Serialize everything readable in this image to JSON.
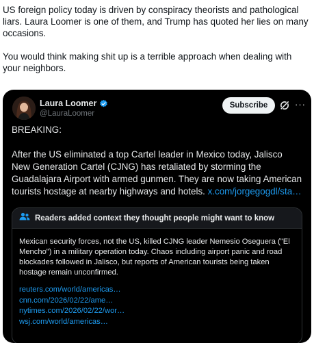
{
  "post": {
    "paragraph1": "US foreign policy today is driven by conspiracy theorists and pathological liars. Laura Loomer is one of them, and Trump has quoted her lies on many occasions.",
    "paragraph2": "You would think making shit up is a terrible approach when dealing with your neighbors."
  },
  "quoted": {
    "display_name": "Laura Loomer",
    "handle": "@LauraLoomer",
    "subscribe_label": "Subscribe",
    "more_label": "···",
    "breaking": "BREAKING:",
    "body": "After the US eliminated a top Cartel leader in Mexico today, Jalisco New Generation Cartel (CJNG) has retaliated by storming the Guadalajara Airport with armed gunmen. They are now taking American tourists hostage at nearby highways and hotels. ",
    "body_link": "x.com/jorgegogdl/sta…"
  },
  "community_note": {
    "title": "Readers added context they thought people might want to know",
    "text": "Mexican security forces, not the US, killed CJNG leader Nemesio Oseguera (\"El Mencho\") in a military operation today. Chaos including airport panic and road blockades followed in Jalisco, but reports of American tourists being taken hostage remain unconfirmed.",
    "links": [
      "reuters.com/world/americas…",
      "cnn.com/2026/02/22/ame…",
      "nytimes.com/2026/02/22/wor…",
      "wsj.com/world/americas…"
    ]
  },
  "colors": {
    "link": "#1d9bf0",
    "verified": "#1d9bf0",
    "card_bg": "#000000"
  },
  "icons": [
    "verified-badge-icon",
    "grok-icon",
    "more-icon",
    "people-icon"
  ]
}
